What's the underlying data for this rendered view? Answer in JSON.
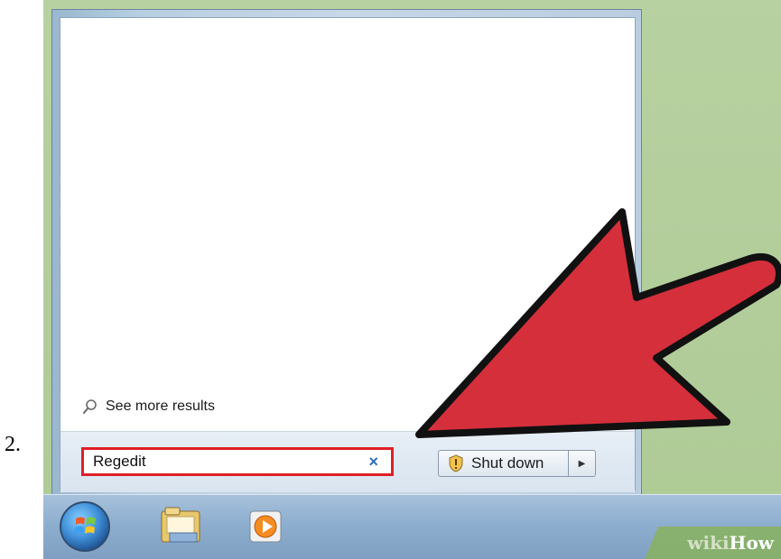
{
  "step": {
    "number": "2."
  },
  "start_menu": {
    "see_more_label": "See more results",
    "search": {
      "value": "Regedit",
      "clear_icon": "×"
    },
    "shutdown": {
      "label": "Shut down",
      "arrow": "▶"
    }
  },
  "taskbar": {
    "icons": [
      "start-orb",
      "windows-explorer-icon",
      "media-player-icon"
    ]
  },
  "watermark": {
    "wiki": "wiki",
    "how": "How"
  },
  "colors": {
    "highlight_red": "#e01f26",
    "arrow_red": "#d42f3b",
    "desktop_green": "#b5cf9e",
    "taskbar_blue": "#8eaecf"
  }
}
